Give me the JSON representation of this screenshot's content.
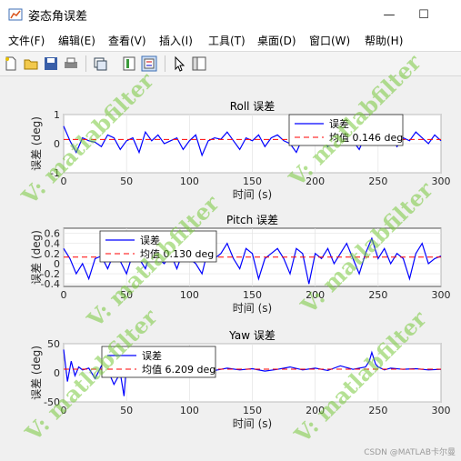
{
  "window": {
    "title": "姿态角误差",
    "minimize": "—",
    "maximize": "☐"
  },
  "menu": [
    "文件(F)",
    "编辑(E)",
    "查看(V)",
    "插入(I)",
    "工具(T)",
    "桌面(D)",
    "窗口(W)",
    "帮助(H)"
  ],
  "toolbar": [
    "new-icon",
    "open-icon",
    "save-icon",
    "print-icon",
    "link-icon",
    "datacursor-icon",
    "colorbar-icon",
    "legend-icon",
    "pointer-icon",
    "propertyeditor-icon"
  ],
  "watermark": "V: matlabfilter",
  "footer": "CSDN @MATLAB卡尔曼",
  "colors": {
    "error_line": "#0000ff",
    "mean_line": "#ff0000",
    "watermark": "#78c83c"
  },
  "chart_data": [
    {
      "type": "line",
      "title": "Roll 误差",
      "xlabel": "时间 (s)",
      "ylabel": "误差 (deg)",
      "xlim": [
        0,
        300
      ],
      "ylim": [
        -1,
        1
      ],
      "xticks": [
        0,
        50,
        100,
        150,
        200,
        250,
        300
      ],
      "yticks": [
        -1,
        0,
        1
      ],
      "grid": true,
      "legend_position": "top-right",
      "mean": 0.146,
      "series": [
        {
          "name": "误差",
          "x": [
            0,
            5,
            10,
            15,
            20,
            25,
            30,
            35,
            40,
            45,
            50,
            55,
            60,
            65,
            70,
            75,
            80,
            85,
            90,
            95,
            100,
            105,
            110,
            115,
            120,
            125,
            130,
            135,
            140,
            145,
            150,
            155,
            160,
            165,
            170,
            175,
            180,
            185,
            190,
            195,
            200,
            205,
            210,
            215,
            220,
            225,
            230,
            235,
            240,
            245,
            250,
            255,
            260,
            265,
            270,
            275,
            280,
            285,
            290,
            295,
            300
          ],
          "y": [
            0.6,
            0.1,
            -0.3,
            0.2,
            0.1,
            0.05,
            -0.1,
            0.3,
            0.2,
            -0.2,
            0.1,
            0.2,
            -0.3,
            0.4,
            0.1,
            0.3,
            0.0,
            0.1,
            0.2,
            -0.2,
            0.1,
            0.3,
            -0.4,
            0.1,
            0.2,
            0.15,
            0.4,
            0.1,
            -0.2,
            0.2,
            0.1,
            0.3,
            -0.1,
            0.2,
            0.3,
            0.1,
            0.0,
            -0.3,
            0.2,
            0.1,
            0.4,
            0.2,
            -0.1,
            0.3,
            0.0,
            0.2,
            0.1,
            -0.2,
            0.3,
            0.2,
            0.1,
            0.0,
            0.3,
            -0.1,
            0.2,
            0.1,
            0.4,
            0.2,
            0.0,
            0.3,
            0.1
          ]
        },
        {
          "name": "均值 0.146 deg",
          "x": [
            0,
            300
          ],
          "y": [
            0.146,
            0.146
          ]
        }
      ]
    },
    {
      "type": "line",
      "title": "Pitch 误差",
      "xlabel": "时间 (s)",
      "ylabel": "误差 (deg)",
      "xlim": [
        0,
        300
      ],
      "ylim": [
        -0.45,
        0.7
      ],
      "xticks": [
        0,
        50,
        100,
        150,
        200,
        250,
        300
      ],
      "yticks": [
        -0.4,
        -0.2,
        0,
        0.2,
        0.4,
        0.6
      ],
      "grid": true,
      "legend_position": "top-left",
      "mean": 0.13,
      "series": [
        {
          "name": "误差",
          "x": [
            0,
            5,
            10,
            15,
            20,
            25,
            30,
            35,
            40,
            45,
            50,
            55,
            60,
            65,
            70,
            75,
            80,
            85,
            90,
            95,
            100,
            105,
            110,
            115,
            120,
            125,
            130,
            135,
            140,
            145,
            150,
            155,
            160,
            165,
            170,
            175,
            180,
            185,
            190,
            195,
            200,
            205,
            210,
            215,
            220,
            225,
            230,
            235,
            240,
            245,
            250,
            255,
            260,
            265,
            270,
            275,
            280,
            285,
            290,
            295,
            300
          ],
          "y": [
            0.3,
            0.1,
            -0.2,
            0.0,
            -0.3,
            0.1,
            0.15,
            -0.1,
            0.2,
            0.05,
            -0.2,
            0.2,
            0.1,
            -0.1,
            0.3,
            0.1,
            0.0,
            0.2,
            -0.1,
            0.25,
            0.1,
            0.0,
            -0.2,
            0.3,
            0.1,
            0.2,
            0.4,
            0.1,
            -0.1,
            0.3,
            0.2,
            -0.3,
            0.1,
            0.2,
            0.3,
            0.1,
            -0.2,
            0.3,
            0.2,
            -0.4,
            0.2,
            0.1,
            0.3,
            0.0,
            0.2,
            0.4,
            0.1,
            -0.2,
            0.2,
            0.5,
            0.1,
            0.3,
            0.0,
            0.2,
            0.1,
            -0.3,
            0.2,
            0.4,
            0.0,
            0.1,
            0.15
          ]
        },
        {
          "name": "均值 0.130 deg",
          "x": [
            0,
            300
          ],
          "y": [
            0.13,
            0.13
          ]
        }
      ]
    },
    {
      "type": "line",
      "title": "Yaw 误差",
      "xlabel": "时间 (s)",
      "ylabel": "误差 (deg)",
      "xlim": [
        0,
        300
      ],
      "ylim": [
        -50,
        50
      ],
      "xticks": [
        0,
        50,
        100,
        150,
        200,
        250,
        300
      ],
      "yticks": [
        -50,
        0,
        50
      ],
      "grid": true,
      "legend_position": "top-center",
      "mean": 6.209,
      "series": [
        {
          "name": "误差",
          "x": [
            0,
            3,
            6,
            9,
            12,
            15,
            20,
            25,
            30,
            35,
            40,
            45,
            48,
            50,
            55,
            60,
            70,
            80,
            90,
            100,
            110,
            120,
            130,
            140,
            150,
            160,
            170,
            180,
            190,
            200,
            210,
            220,
            230,
            240,
            243,
            245,
            248,
            250,
            255,
            260,
            270,
            280,
            290,
            300
          ],
          "y": [
            40,
            -15,
            20,
            -5,
            10,
            5,
            8,
            -10,
            12,
            5,
            -20,
            0,
            -40,
            15,
            5,
            10,
            3,
            8,
            2,
            6,
            10,
            4,
            8,
            5,
            7,
            3,
            6,
            10,
            5,
            8,
            4,
            12,
            6,
            10,
            20,
            35,
            15,
            10,
            5,
            8,
            6,
            7,
            5,
            6
          ]
        },
        {
          "name": "均值 6.209 deg",
          "x": [
            0,
            300
          ],
          "y": [
            6.209,
            6.209
          ]
        }
      ]
    }
  ]
}
